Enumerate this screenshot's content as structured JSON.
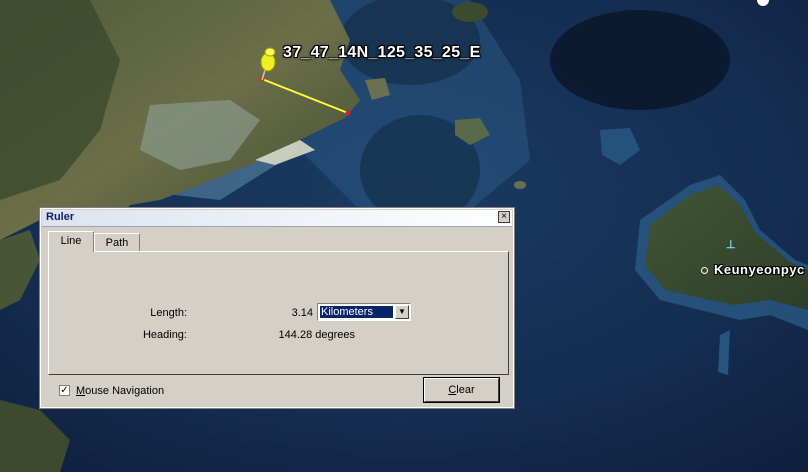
{
  "map": {
    "placemark_label": "37_47_14N_125_35_25_E",
    "place_label": "Keunyeonpyc",
    "ruler_line_color": "#ffff33",
    "water_color": "#132c4e"
  },
  "dialog": {
    "title": "Ruler",
    "close_glyph": "×",
    "tabs": [
      {
        "label": "Line",
        "active": true
      },
      {
        "label": "Path",
        "active": false
      }
    ],
    "length_label": "Length:",
    "length_value": "3.14",
    "unit_selected": "Kilometers",
    "heading_label": "Heading:",
    "heading_value": "144.28 degrees",
    "mouse_navigation_label": "Mouse Navigation",
    "mouse_navigation_checked": true,
    "clear_button": "Clear"
  },
  "icons": {
    "pushpin": "yellow-pushpin-icon",
    "harbor": "harbor-icon",
    "dropdown": "chevron-down-icon",
    "close": "close-icon",
    "check": "checkmark-icon"
  }
}
